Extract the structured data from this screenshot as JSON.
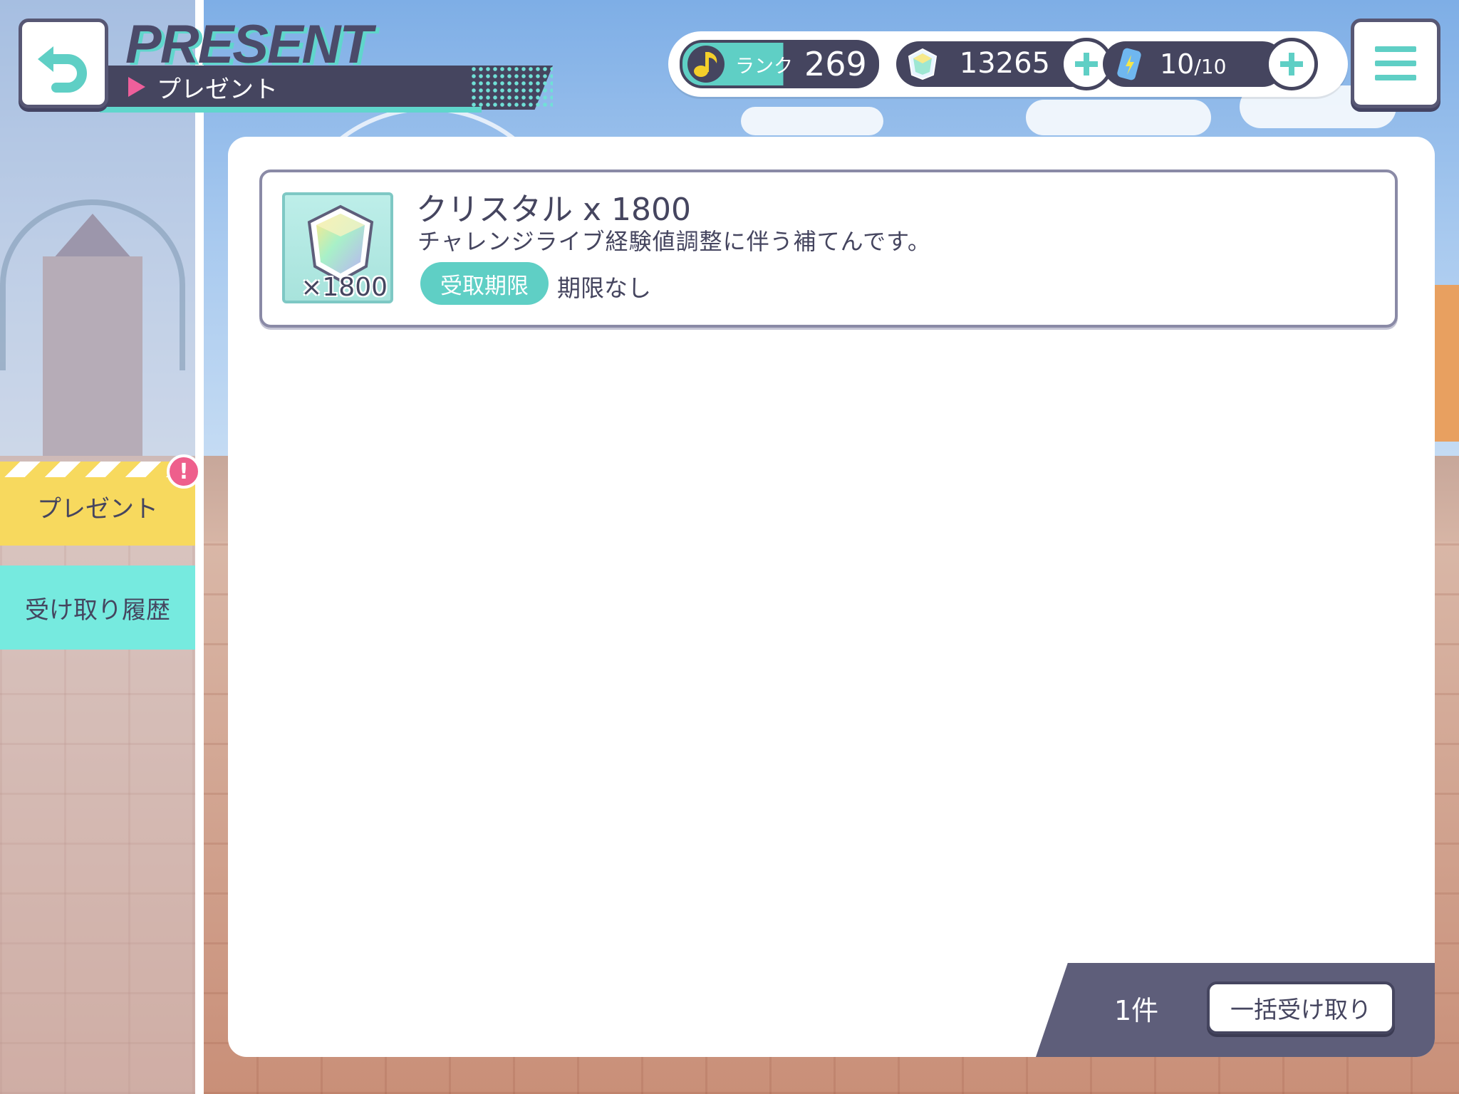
{
  "header": {
    "title_en": "PRESENT",
    "title_jp": "プレゼント"
  },
  "status": {
    "rank_label": "ランク",
    "rank_value": "269",
    "crystal_value": "13265",
    "energy_value": "10",
    "energy_max": "/10"
  },
  "sidebar": {
    "tabs": [
      {
        "label": "プレゼント",
        "selected": true,
        "badge": "!"
      },
      {
        "label": "受け取り履歴",
        "selected": false
      }
    ]
  },
  "presents": [
    {
      "icon": "crystal-icon",
      "quantity": "×1800",
      "name": "クリスタル x 1800",
      "description": "チャレンジライブ経験値調整に伴う補てんです。",
      "deadline_label": "受取期限",
      "deadline_value": "期限なし"
    }
  ],
  "footer": {
    "count": "1件",
    "claim_all_label": "一括受け取り"
  },
  "colors": {
    "accent_teal": "#5fcfc5",
    "navy": "#45455f",
    "tab_yellow": "#f7d95e",
    "tab_mint": "#76eadf",
    "badge_pink": "#ee5f8c"
  }
}
